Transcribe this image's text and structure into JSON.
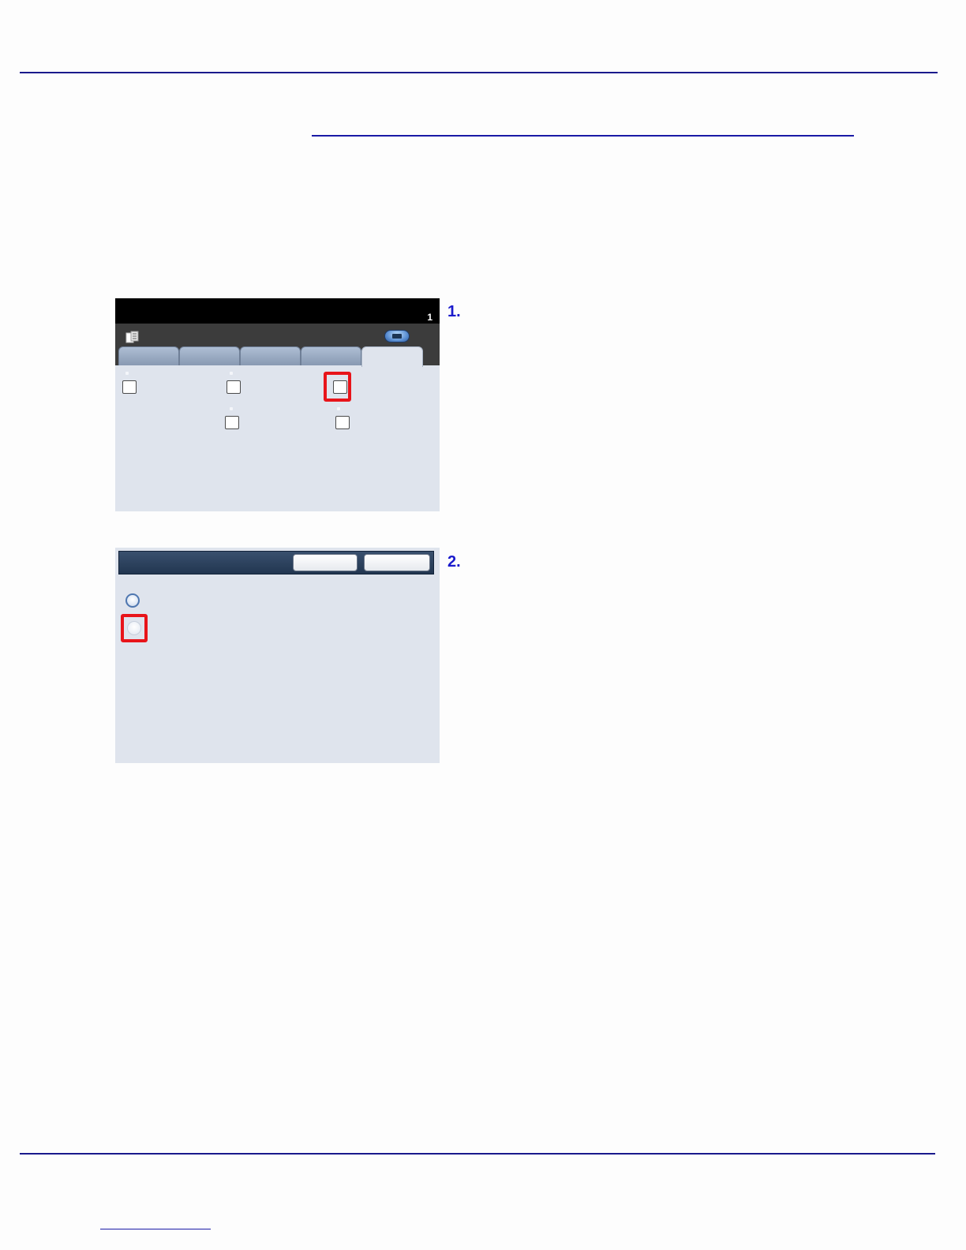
{
  "steps": [
    {
      "number": "1."
    },
    {
      "number": "2."
    }
  ],
  "screen1": {
    "counter": "1",
    "app_icon": "copy-app-icon",
    "toolbar_button_icon": "menu-oval-button-icon",
    "tabs_count": 5,
    "checkbox_icon": "checkbox-icon"
  },
  "screen2": {
    "radio_options": [
      {
        "state": "unselected"
      },
      {
        "state": "selected"
      }
    ]
  },
  "colors": {
    "accent": "#1a1acc",
    "rule": "#1a1a8c",
    "highlight": "#e8141a",
    "panel_background": "#dfe4ed",
    "header_background": "#223650"
  }
}
